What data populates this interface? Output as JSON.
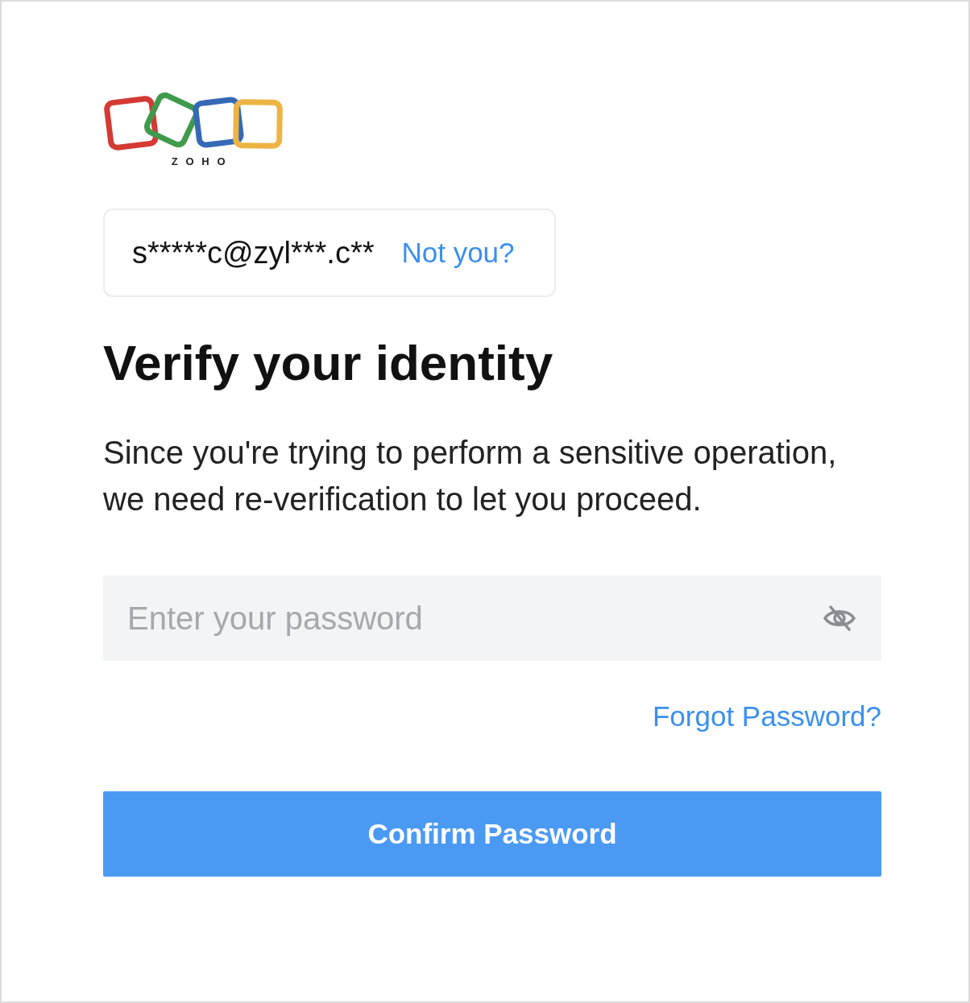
{
  "logo": {
    "text": "ZOHO"
  },
  "account": {
    "email": "s*****c@zyl***.c**",
    "switch_link": "Not you?"
  },
  "heading": "Verify your identity",
  "description": "Since you're trying to perform a sensitive operation, we need re-verification to let you proceed.",
  "password_field": {
    "placeholder": "Enter your password",
    "show_password": false
  },
  "forgot_link": "Forgot Password?",
  "submit_button": "Confirm Password"
}
